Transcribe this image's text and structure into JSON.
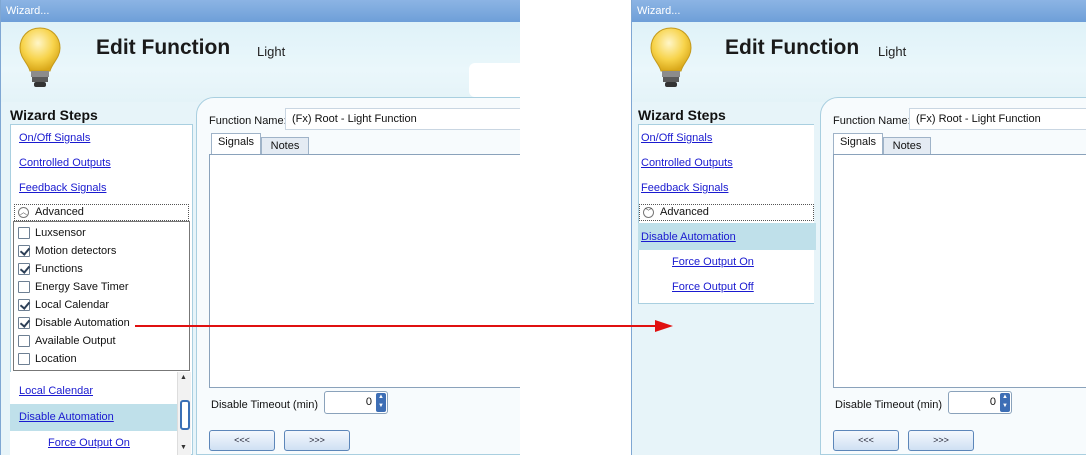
{
  "colors": {
    "titlebar": "#6e9fd8",
    "arrow": "#e01010",
    "link": "#1a1ad0",
    "selected_row": "#bfe0ea"
  },
  "left": {
    "window_title": "Wizard...",
    "header": {
      "title": "Edit Function",
      "subtitle": "Light",
      "icon": "light-bulb-icon"
    },
    "steps_title": "Wizard Steps",
    "steps": [
      "On/Off Signals",
      "Controlled Outputs",
      "Feedback Signals"
    ],
    "advanced": {
      "label": "Advanced",
      "state_icon": "chevron-up-icon"
    },
    "advanced_options": [
      {
        "label": "Luxsensor",
        "checked": false
      },
      {
        "label": "Motion detectors",
        "checked": true
      },
      {
        "label": "Functions",
        "checked": true
      },
      {
        "label": "Energy Save Timer",
        "checked": false
      },
      {
        "label": "Local Calendar",
        "checked": true
      },
      {
        "label": "Disable Automation",
        "checked": true
      },
      {
        "label": "Available Output",
        "checked": false
      },
      {
        "label": "Location",
        "checked": false
      }
    ],
    "lower_steps": [
      "Local Calendar",
      "Disable Automation",
      "Force Output On"
    ],
    "selected_lower_step": "Disable Automation",
    "function_name_label": "Function Name:",
    "function_name_value": "(Fx) Root - Light Function",
    "tabs": [
      "Signals",
      "Notes"
    ],
    "active_tab": "Signals",
    "timeout_label": "Disable Timeout (min)",
    "timeout_value": "0",
    "back_button": "<<<",
    "next_button": ">>>"
  },
  "right": {
    "window_title": "Wizard...",
    "header": {
      "title": "Edit Function",
      "subtitle": "Light",
      "icon": "light-bulb-icon"
    },
    "steps_title": "Wizard Steps",
    "steps": [
      "On/Off Signals",
      "Controlled Outputs",
      "Feedback Signals"
    ],
    "advanced": {
      "label": "Advanced",
      "state_icon": "chevron-down-icon"
    },
    "sub_steps": [
      "Disable Automation",
      "Force Output On",
      "Force Output Off"
    ],
    "selected_step": "Disable Automation",
    "function_name_label": "Function Name:",
    "function_name_value": "(Fx) Root - Light Function",
    "tabs": [
      "Signals",
      "Notes"
    ],
    "active_tab": "Signals",
    "timeout_label": "Disable Timeout (min)",
    "timeout_value": "0",
    "back_button": "<<<",
    "next_button": ">>>"
  }
}
